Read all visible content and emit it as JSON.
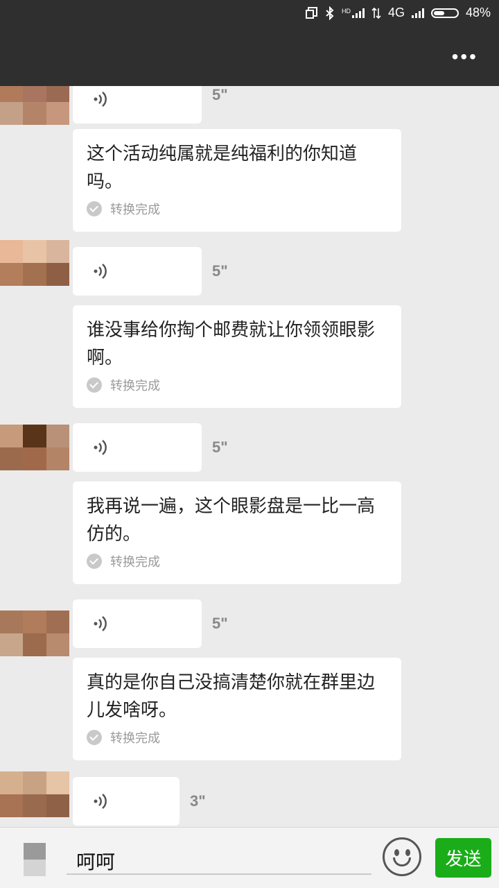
{
  "status_bar": {
    "hd_label": "HD",
    "network_label": "4G",
    "battery_text": "48%",
    "battery_level": 0.48
  },
  "toolbar": {
    "more_label": "•••"
  },
  "messages": [
    {
      "duration": "5\"",
      "text": "这个活动纯属就是纯福利的你知道吗。",
      "status": "转换完成"
    },
    {
      "duration": "5\"",
      "text": "谁没事给你掏个邮费就让你领领眼影啊。",
      "status": "转换完成"
    },
    {
      "duration": "5\"",
      "text": "我再说一遍，这个眼影盘是一比一高仿的。",
      "status": "转换完成"
    },
    {
      "duration": "5\"",
      "text": "真的是你自己没搞清楚你就在群里边儿发啥呀。",
      "status": "转换完成"
    },
    {
      "duration": "3\""
    }
  ],
  "composer": {
    "input_value": "呵呵",
    "send_label": "发送"
  },
  "icons": {
    "voice": "voice-wave-icon",
    "converted": "check-circle-icon",
    "emoji": "smiley-icon",
    "menu": "more-dots-icon"
  },
  "colors": {
    "bar_bg": "#2f2f2f",
    "chat_bg": "#ebebeb",
    "send_button": "#1aad19"
  }
}
